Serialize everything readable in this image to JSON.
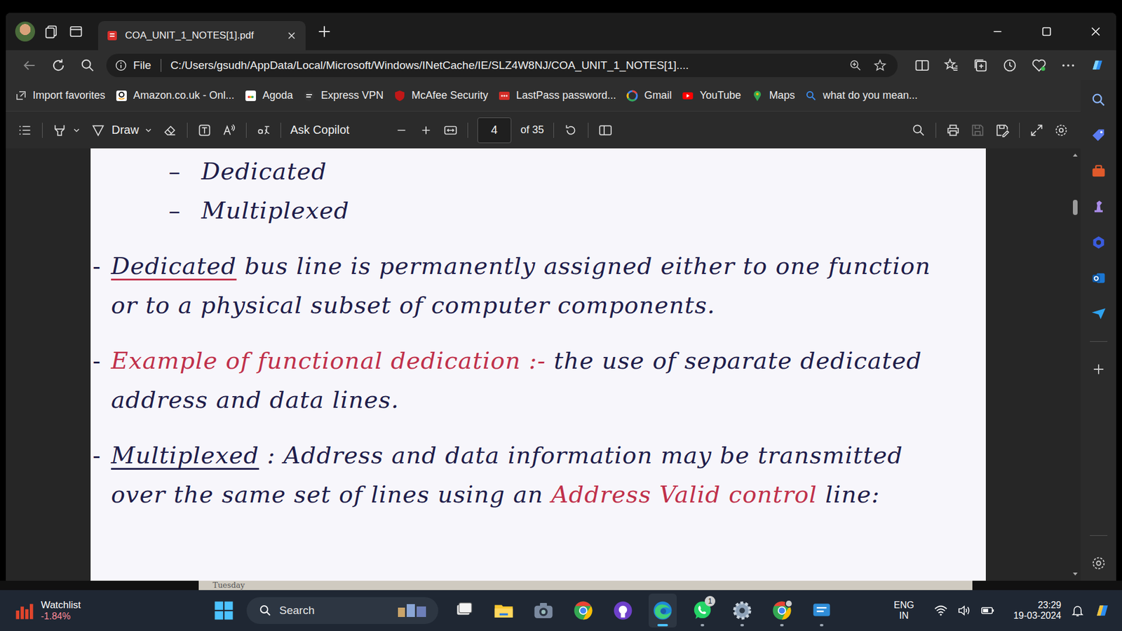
{
  "browser": {
    "tabs": [
      {
        "label": "COA_UNIT_1_NOTES[1].pdf",
        "selected": true
      }
    ],
    "address_bar": {
      "scheme": "File",
      "url": "C:/Users/gsudh/AppData/Local/Microsoft/Windows/INetCache/IE/SLZ4W8NJ/COA_UNIT_1_NOTES[1]...."
    },
    "favorites": [
      {
        "label": "Import favorites"
      },
      {
        "label": "Amazon.co.uk - Onl..."
      },
      {
        "label": "Agoda"
      },
      {
        "label": "Express VPN"
      },
      {
        "label": "McAfee Security"
      },
      {
        "label": "LastPass password..."
      },
      {
        "label": "Gmail"
      },
      {
        "label": "YouTube"
      },
      {
        "label": "Maps"
      },
      {
        "label": "what do you mean..."
      }
    ]
  },
  "pdf_toolbar": {
    "draw": "Draw",
    "ask": "Ask Copilot",
    "page": "4",
    "page_count": "of 35",
    "save": {
      "disabled": true
    }
  },
  "document": {
    "blocks": [
      {
        "kind": "sub",
        "bullet": "–",
        "segments": [
          {
            "text": "Dedicated",
            "color": "#1f1d4a",
            "underline": false
          }
        ]
      },
      {
        "kind": "sub",
        "bullet": "–",
        "segments": [
          {
            "text": "Multiplexed",
            "color": "#1f1d4a",
            "underline": false
          }
        ]
      },
      {
        "kind": "point",
        "bullet": "-",
        "segments": [
          {
            "text": "Dedicated",
            "color": "#1f1d4a",
            "underline": true,
            "underline_color": "#c0304a"
          },
          {
            "text": " bus line is permanently assigned either to one function or to a physical subset of computer components.",
            "color": "#1f1d4a",
            "underline": false
          }
        ]
      },
      {
        "kind": "point",
        "bullet": "-",
        "segments": [
          {
            "text": "Example of functional dedication :-",
            "color": "#c0304a",
            "underline": false
          },
          {
            "text": " the use of separate dedicated address and data lines.",
            "color": "#1f1d4a",
            "underline": false
          }
        ]
      },
      {
        "kind": "point",
        "bullet": "-",
        "segments": [
          {
            "text": "Multiplexed",
            "color": "#1f1d4a",
            "underline": true,
            "underline_color": "#1f1d4a"
          },
          {
            "text": " : Address and data information may be transmitted over the same set of lines using an ",
            "color": "#1f1d4a",
            "underline": false
          },
          {
            "text": "Address Valid control",
            "color": "#c0304a",
            "underline": false
          },
          {
            "text": " line:",
            "color": "#1f1d4a",
            "underline": false
          }
        ]
      }
    ]
  },
  "desktop": {
    "label": "Tuesday"
  },
  "taskbar": {
    "widget": {
      "title": "Watchlist",
      "value": "-1.84%"
    },
    "search": {
      "placeholder": "Search"
    },
    "apps": [
      {
        "open": false,
        "active": false
      },
      {
        "open": false,
        "active": false
      },
      {
        "open": false,
        "active": false
      },
      {
        "open": false,
        "active": false
      },
      {
        "open": false,
        "active": false
      },
      {
        "open": true,
        "active": true
      },
      {
        "open": true,
        "active": false,
        "badge": "1"
      },
      {
        "open": true,
        "active": false
      },
      {
        "open": true,
        "active": false
      },
      {
        "open": true,
        "active": false
      }
    ],
    "tray": {
      "lang": "ENG",
      "region": "IN",
      "time": "23:29",
      "date": "19-03-2024"
    }
  }
}
